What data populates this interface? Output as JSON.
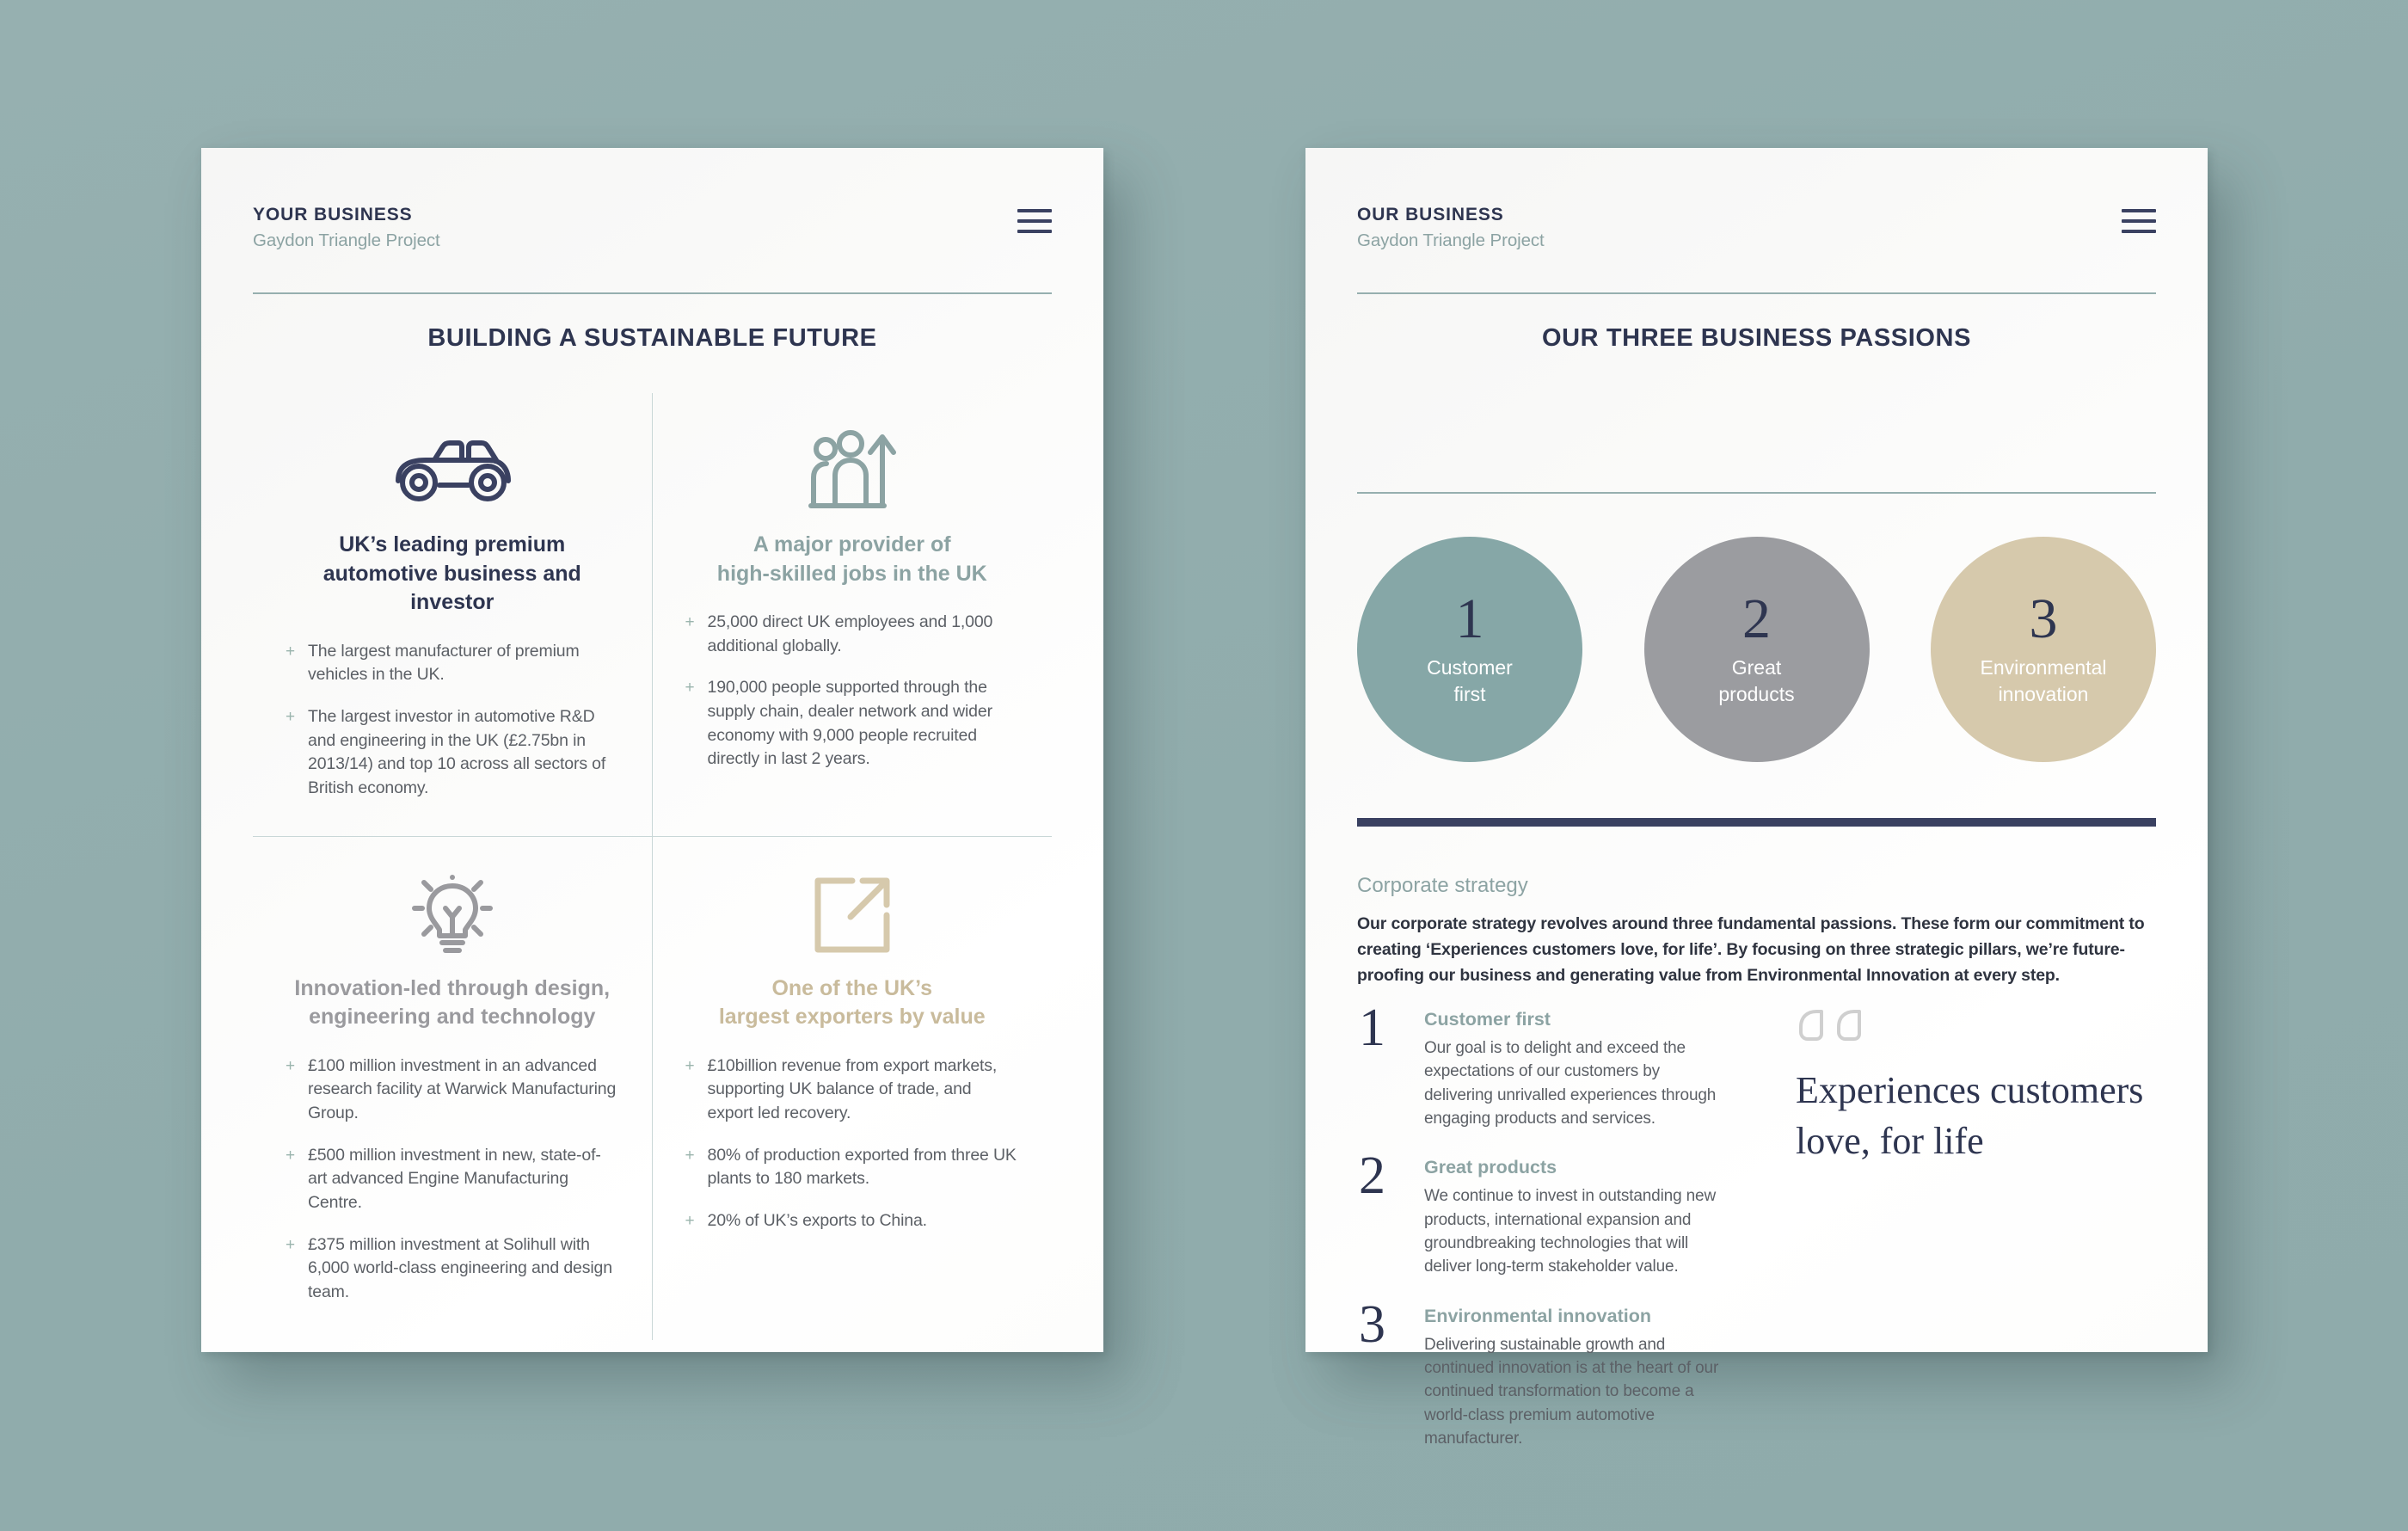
{
  "background_color": "#93aeae",
  "left_card": {
    "brand": {
      "main": "YOUR BUSINESS",
      "sub": "Gaydon Triangle Project"
    },
    "menu_icon": "hamburger-menu-icon",
    "title": "BUILDING A SUSTAINABLE FUTURE",
    "quadrants": [
      {
        "icon": "car-icon",
        "icon_color": "#3a4161",
        "heading": "UK’s leading premium\nautomotive business and investor",
        "heading_color": "#2e3550",
        "bullets": [
          "The largest manufacturer of premium vehicles in the UK.",
          "The largest investor in automotive R&D and engineering in the UK (£2.75bn in 2013/14) and top 10 across all sectors of British economy."
        ]
      },
      {
        "icon": "people-growth-icon",
        "icon_color": "#8ca3a3",
        "heading": "A major provider of\nhigh-skilled jobs in the UK",
        "heading_color": "#8ca3a3",
        "bullets": [
          "25,000 direct UK employees and 1,000 additional globally.",
          "190,000 people supported through the supply chain, dealer network and wider economy with 9,000 people recruited directly in last 2 years."
        ]
      },
      {
        "icon": "lightbulb-icon",
        "icon_color": "#9a9a9e",
        "heading": "Innovation-led through design,\nengineering and technology",
        "heading_color": "#9a9a9e",
        "bullets": [
          "£100 million investment in an advanced research facility at Warwick Manufacturing Group.",
          "£500 million investment in new, state-of-art advanced Engine Manufacturing Centre.",
          "£375 million investment at Solihull with 6,000 world-class engineering and design team."
        ]
      },
      {
        "icon": "export-arrow-icon",
        "icon_color": "#d6c9ac",
        "heading": "One of the UK’s\nlargest exporters by value",
        "heading_color": "#c9bb9c",
        "bullets": [
          "£10billion revenue from export markets, supporting UK balance of trade, and export led recovery.",
          "80% of production exported from three UK plants to 180 markets.",
          "20% of UK’s exports to China."
        ]
      }
    ]
  },
  "right_card": {
    "brand": {
      "main": "OUR BUSINESS",
      "sub": "Gaydon Triangle Project"
    },
    "menu_icon": "hamburger-menu-icon",
    "title": "OUR THREE BUSINESS PASSIONS",
    "circles": [
      {
        "number": "1",
        "label": "Customer\nfirst",
        "color": "#86a7a7"
      },
      {
        "number": "2",
        "label": "Great\nproducts",
        "color": "#9b9ca0"
      },
      {
        "number": "3",
        "label": "Environmental\ninnovation",
        "color": "#d6c9ac"
      }
    ],
    "divider_color": "#3a4161",
    "strategy": {
      "heading": "Corporate strategy",
      "body": "Our corporate strategy revolves around three fundamental passions. These form our commitment to creating ‘Experiences customers love, for life’. By focusing on three strategic pillars, we’re future-proofing our business and generating value from Environmental Innovation at every step."
    },
    "pillars": [
      {
        "number": "1",
        "title": "Customer first",
        "body": "Our goal is to delight and exceed the expectations of our customers by delivering unrivalled experiences through engaging products and services."
      },
      {
        "number": "2",
        "title": "Great products",
        "body": "We continue to invest in outstanding new products, international expansion and groundbreaking technologies that will deliver long-term stakeholder value."
      },
      {
        "number": "3",
        "title": "Environmental innovation",
        "body": "Delivering sustainable growth and continued innovation is at the heart of our continued transformation to become a world-class premium automotive manufacturer."
      }
    ],
    "quote": {
      "icon": "quotation-mark-icon",
      "text": "Experiences customers love, for life"
    }
  }
}
